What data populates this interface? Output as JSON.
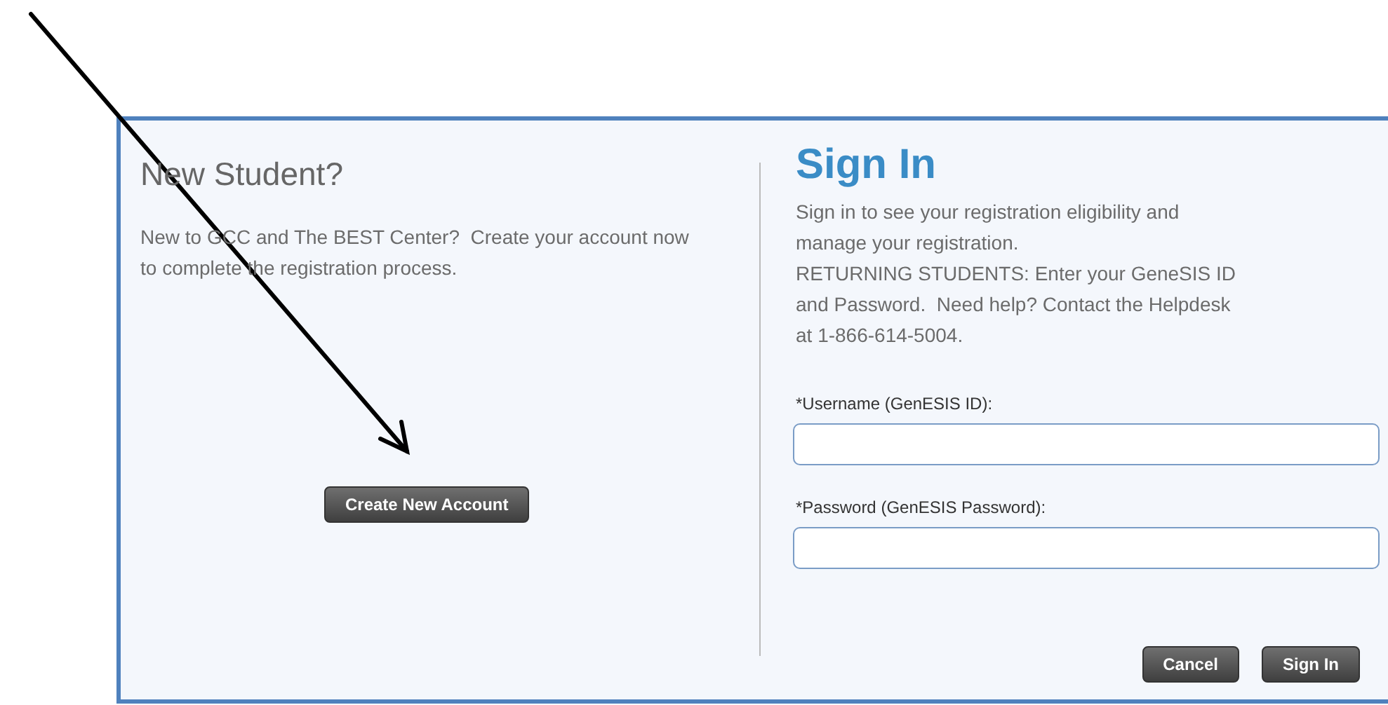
{
  "new_student": {
    "title": "New Student?",
    "text": "New to GCC and The BEST Center?  Create your account now to complete the registration process.",
    "button": "Create New Account"
  },
  "sign_in": {
    "title": "Sign In",
    "intro": "Sign in to see your registration eligibility and manage your registration.",
    "returning": "RETURNING STUDENTS: Enter your GeneSIS ID and Password.  Need help? Contact the Helpdesk at 1-866-614-5004.",
    "fields": [
      {
        "label": "*Username (GenESIS ID):"
      },
      {
        "label": "*Password (GenESIS Password):"
      }
    ],
    "buttons": [
      "Cancel",
      "Sign In"
    ]
  }
}
